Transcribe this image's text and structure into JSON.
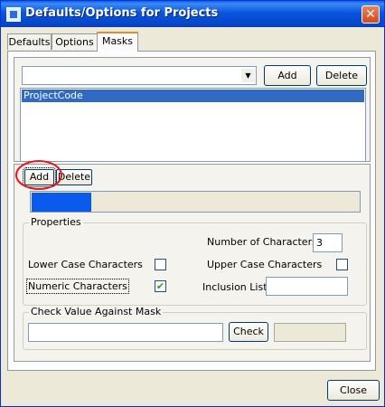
{
  "window": {
    "title": "Defaults/Options for Projects",
    "close_glyph": "✕"
  },
  "tabs": [
    {
      "label": "Defaults"
    },
    {
      "label": "Options"
    },
    {
      "label": "Masks"
    }
  ],
  "mask_select": {
    "value": "",
    "add_label": "Add",
    "delete_label": "Delete"
  },
  "mask_list": {
    "items": [
      "ProjectCode"
    ],
    "selected": "ProjectCode"
  },
  "segment": {
    "add_label": "Add",
    "delete_label": "Delete",
    "selected_fill": "#0a5aeb"
  },
  "properties": {
    "legend": "Properties",
    "num_chars_label": "Number of Characters:",
    "num_chars_value": "3",
    "lower_label": "Lower Case Characters",
    "lower_checked": false,
    "upper_label": "Upper Case Characters",
    "upper_checked": false,
    "numeric_label": "Numeric Characters",
    "numeric_checked": true,
    "numeric_check_glyph": "✔",
    "inclusion_label": "Inclusion List:",
    "inclusion_value": ""
  },
  "check": {
    "legend": "Check Value Against Mask",
    "input_value": "",
    "button_label": "Check",
    "result_value": ""
  },
  "footer": {
    "close_label": "Close"
  },
  "annotation": {
    "color": "#e8141b"
  }
}
